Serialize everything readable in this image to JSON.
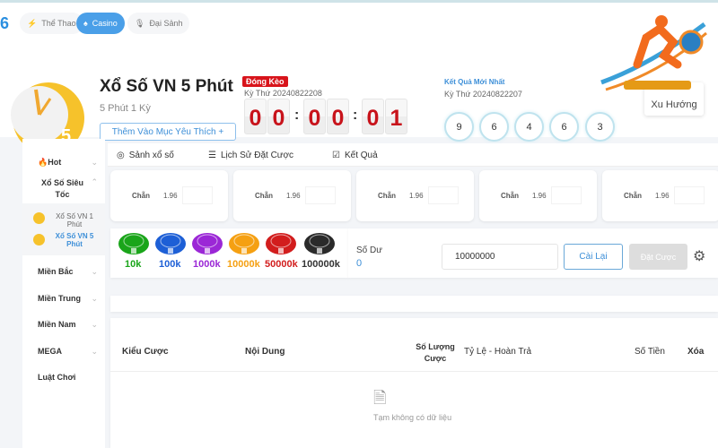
{
  "nav": {
    "brand": "6",
    "items": [
      {
        "label": "Thể Thao",
        "icon": "lightning-icon"
      },
      {
        "label": "Casino",
        "icon": "spade-icon",
        "active": true
      },
      {
        "label": "Đại Sảnh",
        "icon": "microphone-icon"
      }
    ]
  },
  "game": {
    "title": "Xổ Số VN 5 Phút",
    "subtitle": "5 Phút 1 Kỳ",
    "favorite_label": "Thêm Vào Mục Yêu Thích +",
    "status_badge": "Đóng Kèo",
    "current_period": "Kỳ Thứ 20240822208",
    "countdown": [
      "0",
      "0",
      "0",
      "0",
      "0",
      "1"
    ]
  },
  "latest": {
    "title": "Kết Quả Mới Nhất",
    "period": "Kỳ Thứ 20240822207",
    "balls": [
      "9",
      "6",
      "4",
      "6",
      "3"
    ]
  },
  "trend_label": "Xu Hướng",
  "sidebar": {
    "items": [
      {
        "label": "Hot"
      },
      {
        "label": "Xổ Số Siêu Tốc"
      },
      {
        "label": "Miền Bắc"
      },
      {
        "label": "Miền Trung"
      },
      {
        "label": "Miền Nam"
      },
      {
        "label": "MEGA"
      },
      {
        "label": "Luật Chơi"
      }
    ],
    "sub_items": [
      {
        "label": "Xổ Số VN 1 Phút"
      },
      {
        "label": "Xổ Số VN 5 Phút",
        "active": true
      }
    ]
  },
  "tabs": [
    {
      "label": "Sảnh xổ số"
    },
    {
      "label": "Lịch Sử Đặt Cược"
    },
    {
      "label": "Kết Quả"
    }
  ],
  "bet_cards": [
    {
      "label": "Chẵn",
      "odds": "1.96"
    },
    {
      "label": "Chẵn",
      "odds": "1.96"
    },
    {
      "label": "Chẵn",
      "odds": "1.96"
    },
    {
      "label": "Chẵn",
      "odds": "1.96"
    },
    {
      "label": "Chẵn",
      "odds": "1.96"
    }
  ],
  "chips": [
    {
      "label": "10k",
      "color": "#1aa51a"
    },
    {
      "label": "100k",
      "color": "#1d5fd6"
    },
    {
      "label": "1000k",
      "color": "#9b27d6"
    },
    {
      "label": "10000k",
      "color": "#f5a012"
    },
    {
      "label": "50000k",
      "color": "#d21d1d"
    },
    {
      "label": "100000k",
      "color": "#2a2a2a"
    }
  ],
  "balance": {
    "label": "Số Dư",
    "value": "0",
    "amount": "10000000",
    "reset_label": "Cài Lại",
    "place_label": "Đặt Cược"
  },
  "table": {
    "headers": [
      "Kiểu Cược",
      "Nội Dung",
      "Số Lượng Cược",
      "Tỷ Lệ - Hoàn Trả",
      "Số Tiền",
      "Xóa"
    ],
    "empty_text": "Tạm không có dữ liệu"
  }
}
